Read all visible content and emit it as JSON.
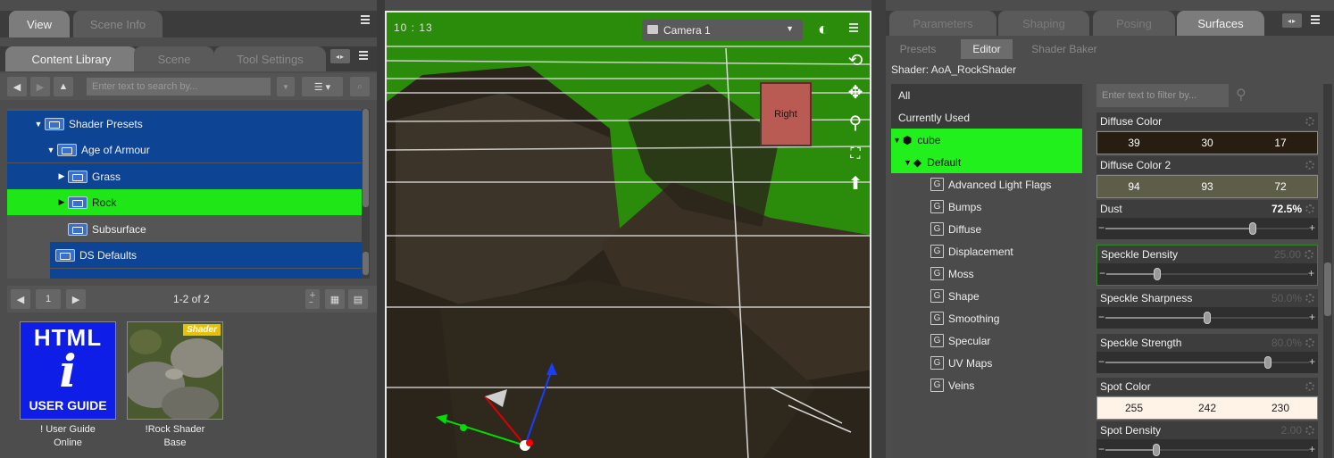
{
  "left_panel": {
    "top_tabs": [
      "View",
      "Scene Info"
    ],
    "tabs": [
      "Content Library",
      "Scene",
      "Tool Settings"
    ],
    "search": {
      "placeholder": "Enter text to search by..."
    },
    "tree": [
      {
        "label": "Shader Presets",
        "expanded": true,
        "state": "selected",
        "level": 1
      },
      {
        "label": "Age of Armour",
        "expanded": true,
        "state": "selected",
        "level": 2
      },
      {
        "label": "Grass",
        "expanded": false,
        "state": "selected",
        "level": 3
      },
      {
        "label": "Rock",
        "expanded": false,
        "state": "highlighted",
        "level": 3
      },
      {
        "label": "Subsurface",
        "state": "normal",
        "level": 3
      },
      {
        "label": "DS Defaults",
        "state": "selected",
        "level": 2
      }
    ],
    "pager": {
      "page": "1",
      "range": "1-2 of 2"
    },
    "thumbnails": [
      {
        "art_text": {
          "line1": "HTML",
          "glyph": "i",
          "line2": "USER GUIDE"
        },
        "label_line1": "! User Guide",
        "label_line2": "Online"
      },
      {
        "badge": "Shader",
        "label_line1": "!Rock Shader",
        "label_line2": "Base"
      }
    ],
    "colors": {
      "selected": "#0d4494",
      "highlight": "#1ee617"
    }
  },
  "viewport": {
    "timecode": "10 : 13",
    "camera": "Camera 1",
    "cube_face": "Right",
    "colors": {
      "background": "#2a8c0a",
      "rock": "#3a3226",
      "grid": "#d8d8d8"
    }
  },
  "right_panel": {
    "tabs": [
      "Parameters",
      "Shaping",
      "Posing",
      "Surfaces"
    ],
    "subtabs": [
      "Presets",
      "Editor",
      "Shader Baker"
    ],
    "shader_line": "Shader: AoA_RockShader",
    "tree": {
      "all": "All",
      "currently_used": "Currently Used",
      "object": "cube",
      "surface": "Default",
      "groups": [
        "Advanced Light Flags",
        "Bumps",
        "Diffuse",
        "Displacement",
        "Moss",
        "Shape",
        "Smoothing",
        "Specular",
        "UV Maps",
        "Veins"
      ],
      "group_glyph": "G"
    },
    "filter": {
      "placeholder": "Enter text to filter by..."
    },
    "properties": [
      {
        "name": "Diffuse Color",
        "kind": "color",
        "rgb": [
          "39",
          "30",
          "17"
        ],
        "swatch": "#271e11"
      },
      {
        "name": "Diffuse Color 2",
        "kind": "color",
        "rgb": [
          "94",
          "93",
          "72"
        ],
        "swatch": "#5e5d48"
      },
      {
        "name": "Dust",
        "kind": "slider",
        "value": "72.5%",
        "fraction": 0.725,
        "dim": false
      },
      {
        "name": "Speckle Density",
        "kind": "slider",
        "value": "25.00",
        "fraction": 0.25,
        "dim": true,
        "focused": true
      },
      {
        "name": "Speckle Sharpness",
        "kind": "slider",
        "value": "50.0%",
        "fraction": 0.5,
        "dim": true
      },
      {
        "name": "Speckle Strength",
        "kind": "slider",
        "value": "80.0%",
        "fraction": 0.8,
        "dim": true
      },
      {
        "name": "Spot Color",
        "kind": "color",
        "rgb": [
          "255",
          "242",
          "230"
        ],
        "swatch": "#fff2e6"
      },
      {
        "name": "Spot Density",
        "kind": "slider",
        "value": "2.00",
        "fraction": 0.25,
        "dim": true
      }
    ]
  }
}
